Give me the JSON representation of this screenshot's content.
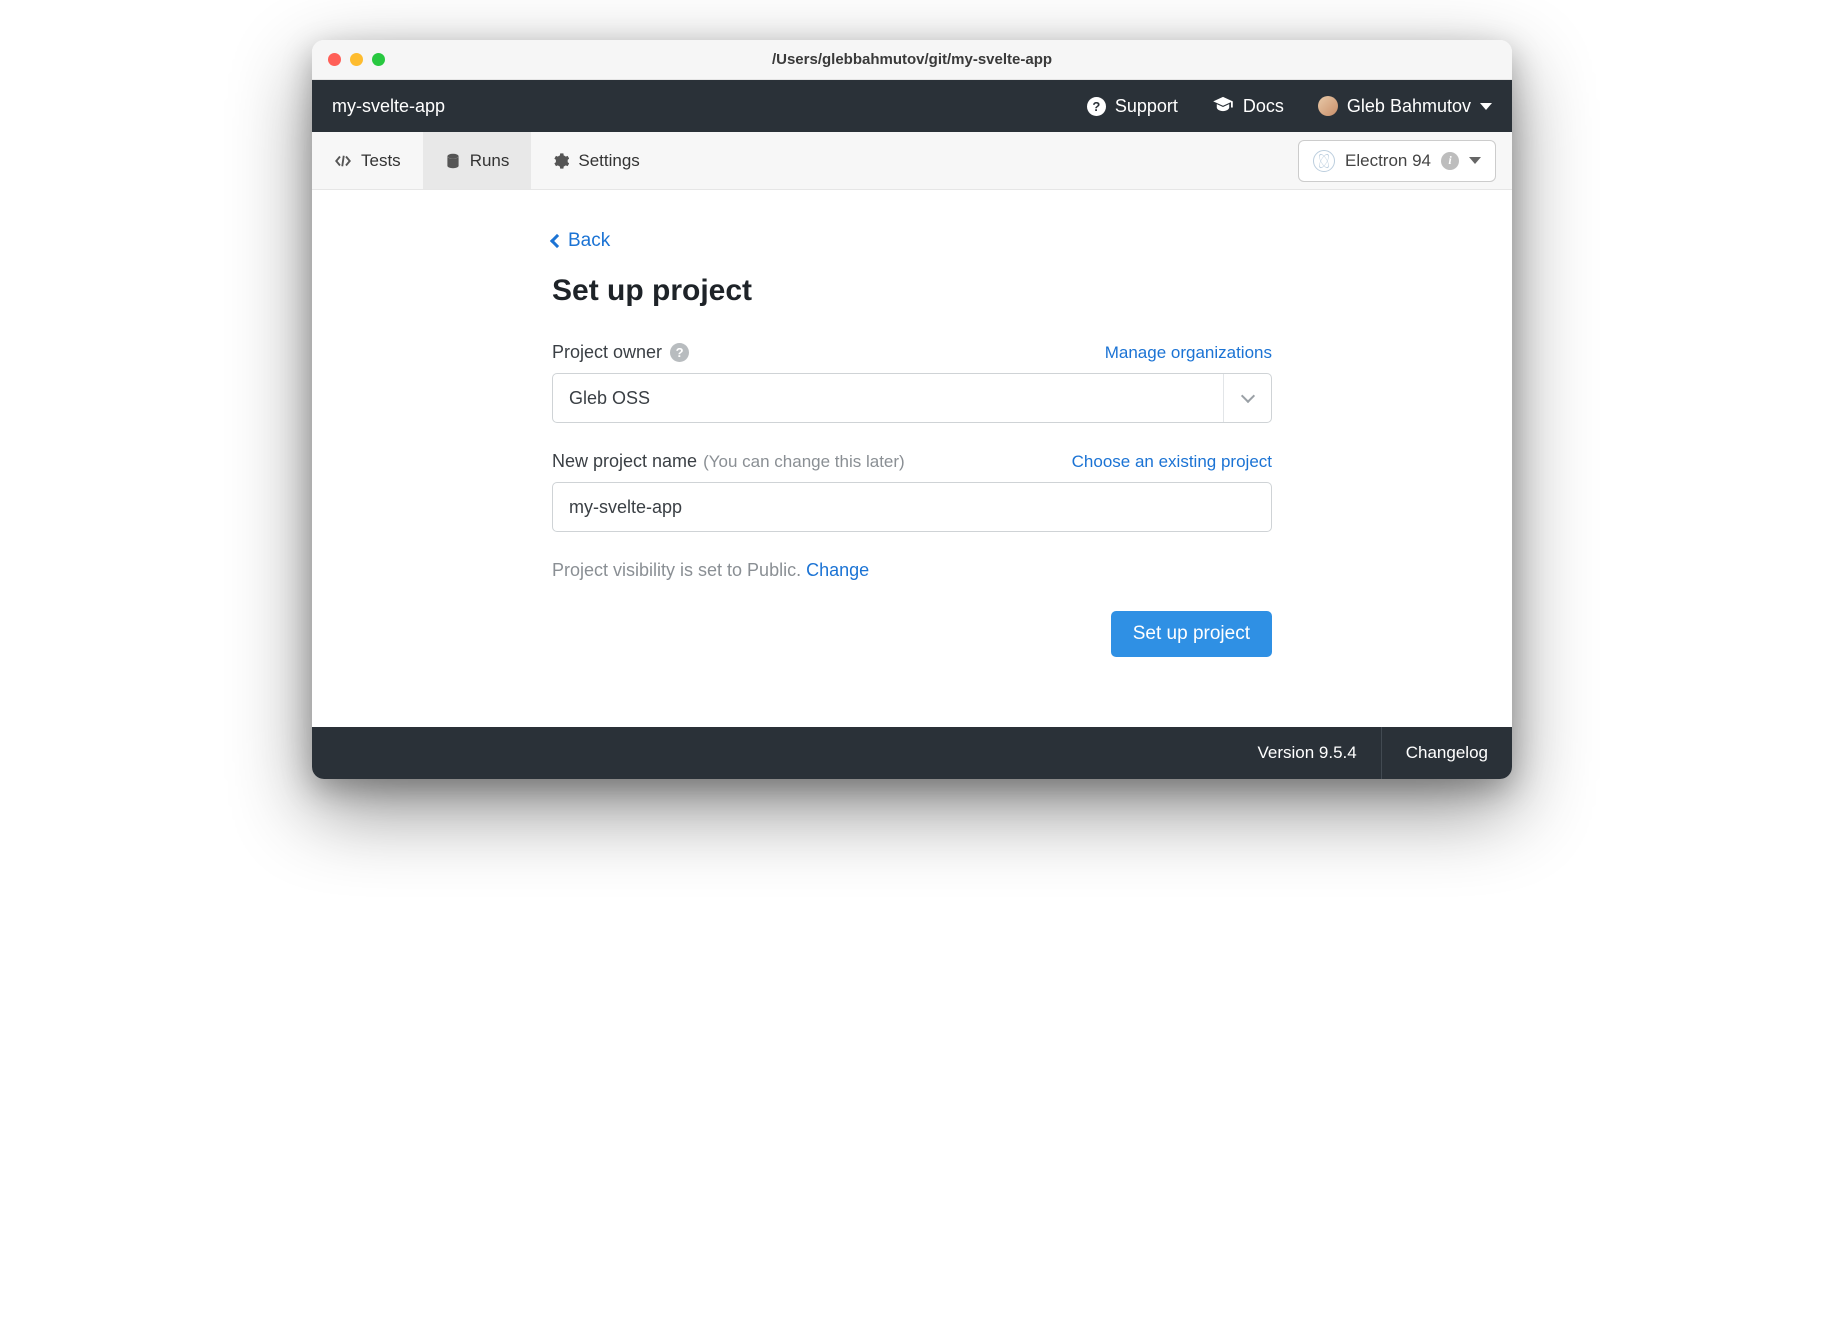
{
  "window": {
    "title": "/Users/glebbahmutov/git/my-svelte-app"
  },
  "topbar": {
    "app_name": "my-svelte-app",
    "support_label": "Support",
    "docs_label": "Docs",
    "user_name": "Gleb Bahmutov"
  },
  "tabs": {
    "tests": "Tests",
    "runs": "Runs",
    "settings": "Settings",
    "active": "runs"
  },
  "browser": {
    "label": "Electron 94"
  },
  "back": {
    "label": "Back"
  },
  "page": {
    "title": "Set up project"
  },
  "owner": {
    "label": "Project owner",
    "manage_link": "Manage organizations",
    "value": "Gleb OSS"
  },
  "project_name": {
    "label": "New project name",
    "hint": "(You can change this later)",
    "choose_link": "Choose an existing project",
    "value": "my-svelte-app"
  },
  "visibility": {
    "text": "Project visibility is set to Public. ",
    "change": "Change"
  },
  "submit": {
    "label": "Set up project"
  },
  "footer": {
    "version": "Version 9.5.4",
    "changelog": "Changelog"
  }
}
